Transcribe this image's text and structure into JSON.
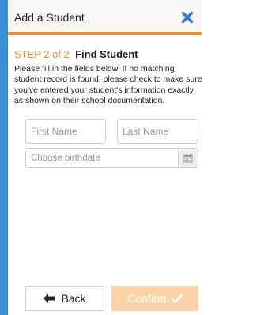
{
  "dialog": {
    "title": "Add a Student",
    "close_icon": "close-icon"
  },
  "step": {
    "prefix": "STEP 2 of 2",
    "title": "Find Student"
  },
  "description": "Please fill in the fields below. If no matching student record is found, please check to make sure you've entered your student's information exactly as shown on their school documentation.",
  "form": {
    "first_name": {
      "placeholder": "First Name",
      "value": ""
    },
    "last_name": {
      "placeholder": "Last Name",
      "value": ""
    },
    "birthdate": {
      "placeholder": "Choose birthdate",
      "value": "",
      "icon": "calendar-icon"
    }
  },
  "actions": {
    "back_label": "Back",
    "back_icon": "arrow-left-icon",
    "confirm_label": "Confirm",
    "confirm_icon": "check-icon",
    "confirm_enabled": false
  },
  "colors": {
    "accent_blue": "#3a8fd4",
    "accent_orange": "#f28c28",
    "confirm_disabled": "#fcd3a8",
    "close_blue": "#2f7fd0"
  }
}
